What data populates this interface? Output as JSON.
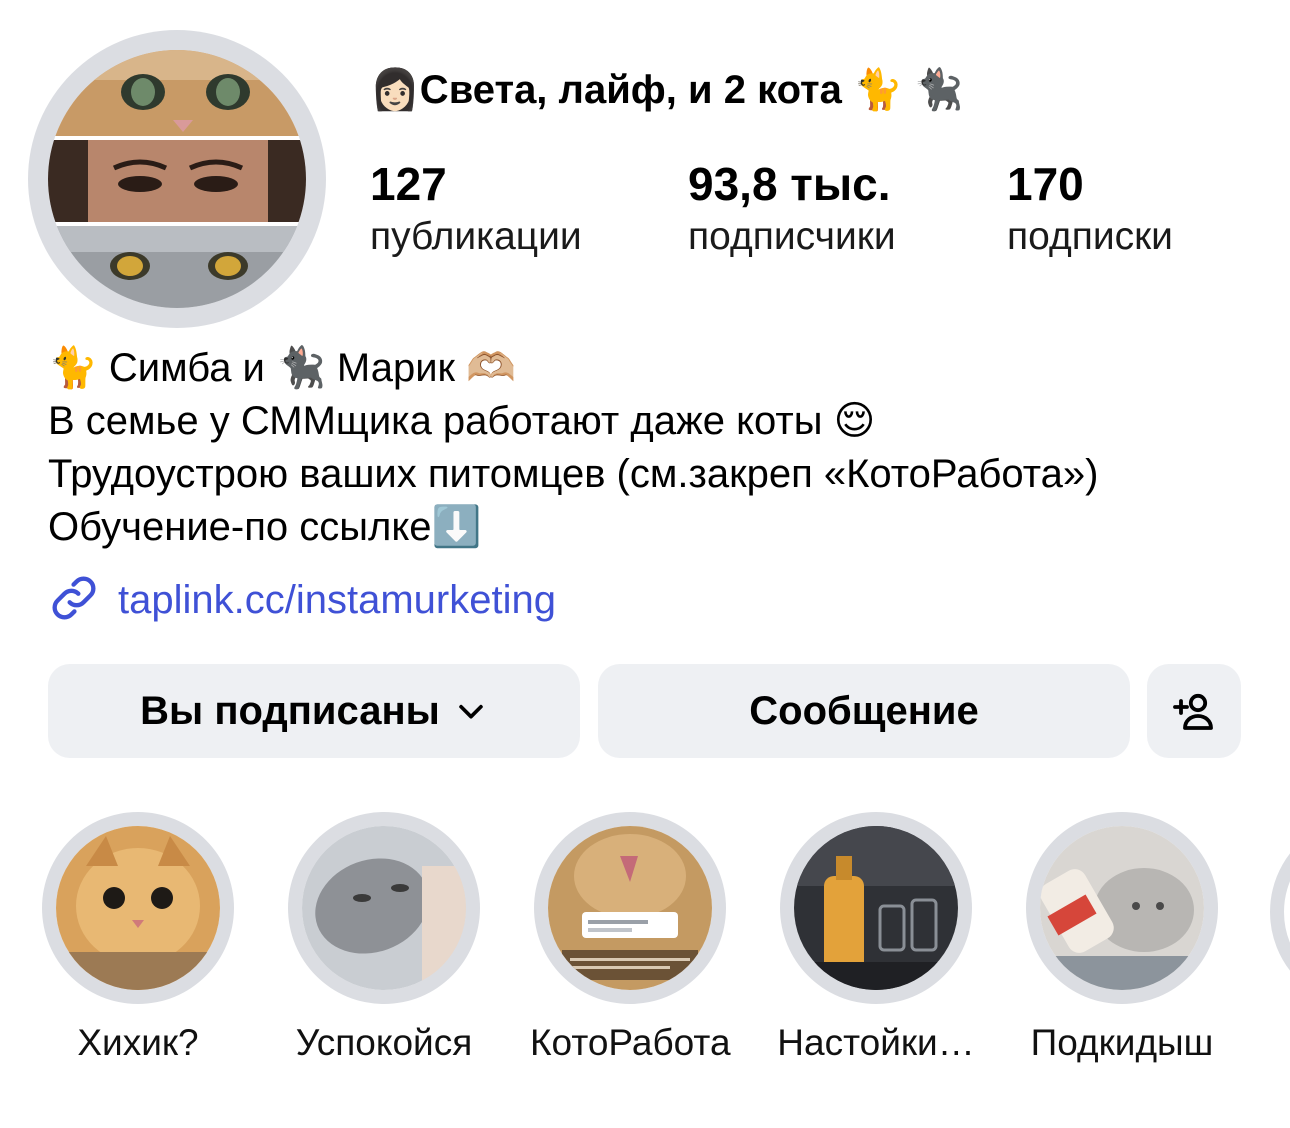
{
  "profile": {
    "display_name": "👩🏻Света, лайф, и 2 кота 🐈 🐈‍⬛",
    "avatar_icon": "avatar-collage"
  },
  "stats": [
    {
      "value": "127",
      "label": "публикации"
    },
    {
      "value": "93,8 тыс.",
      "label": "подписчики"
    },
    {
      "value": "170",
      "label": "подписки"
    }
  ],
  "bio": {
    "lines": [
      "🐈 Симба и 🐈‍⬛ Марик 🫶🏼",
      "В семье у СММщика работают даже коты 😌",
      "Трудоустрою ваших питомцев (см.закреп «КотоРабота»)",
      "Обучение-по ссылке⬇️"
    ],
    "link": "taplink.cc/instamurketing",
    "link_icon": "link-icon",
    "link_color": "#3f51d6"
  },
  "actions": {
    "follow_label": "Вы подписаны",
    "follow_icon": "chevron-down-icon",
    "message_label": "Сообщение",
    "add_icon": "add-person-icon"
  },
  "highlights": [
    {
      "label": "Хихик?"
    },
    {
      "label": "Успокойся"
    },
    {
      "label": "КотоРабота"
    },
    {
      "label": "Настойки…"
    },
    {
      "label": "Подкидыш"
    }
  ],
  "colors": {
    "button_bg": "#eef0f3",
    "ring": "#dbdde2"
  }
}
